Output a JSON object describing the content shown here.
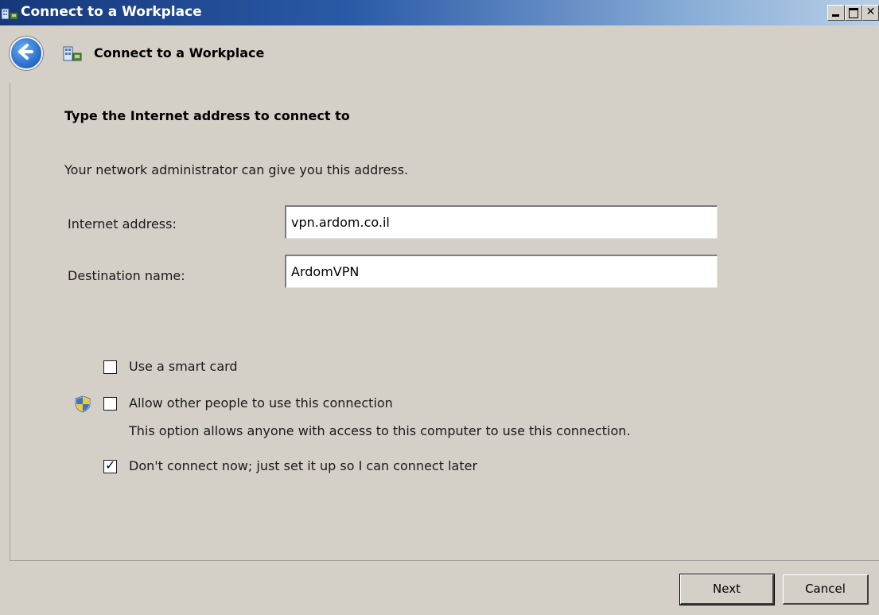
{
  "window": {
    "title": "Connect to a Workplace",
    "minimize_icon": "minimize-icon",
    "maximize_icon": "maximize-icon",
    "close_icon": "close-icon"
  },
  "header": {
    "back_icon": "back-arrow-icon",
    "app_icon": "network-connection-icon",
    "title": "Connect to a Workplace"
  },
  "main": {
    "instruction": "Type the Internet address to connect to",
    "help_text": "Your network administrator can give you this address.",
    "fields": [
      {
        "label": "Internet address:",
        "value": "vpn.ardom.co.il"
      },
      {
        "label": "Destination name:",
        "value": "ArdomVPN"
      }
    ],
    "options": [
      {
        "label": "Use a smart card",
        "checked": false
      },
      {
        "label": "Allow other people to use this connection",
        "checked": false,
        "icon": "uac-shield-icon"
      },
      {
        "label": "Don't connect now; just set it up so I can connect later",
        "checked": true
      }
    ],
    "allow_note": "This option allows anyone with access to this computer to use this connection."
  },
  "footer": {
    "next_label": "Next",
    "cancel_label": "Cancel"
  },
  "colors": {
    "background": "#d4d0c8",
    "titlebar_start": "#16387a",
    "titlebar_end": "#b8cfe6",
    "back_button": "#2f77d2"
  }
}
